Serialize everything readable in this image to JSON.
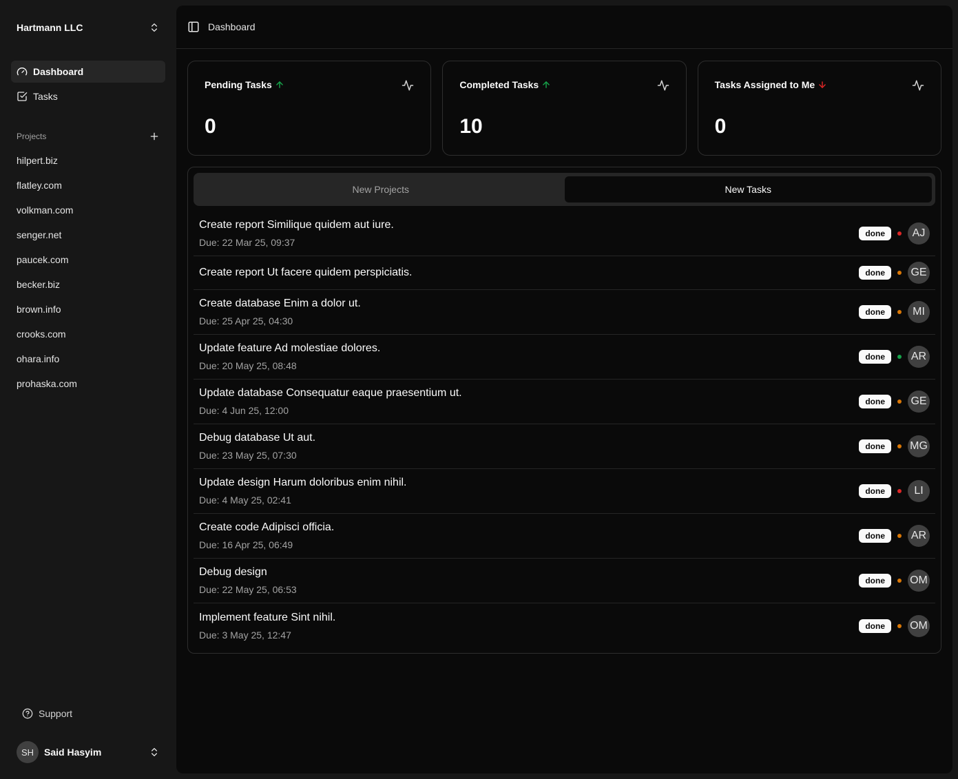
{
  "colors": {
    "priority_high": "#dc2626",
    "priority_medium": "#d97706",
    "priority_low": "#16a34a",
    "trend_up": "#16a34a",
    "trend_down": "#dc2626"
  },
  "sidebar": {
    "team_name": "Hartmann LLC",
    "nav": [
      {
        "label": "Dashboard",
        "icon": "gauge-icon",
        "active": true
      },
      {
        "label": "Tasks",
        "icon": "square-check-icon",
        "active": false
      }
    ],
    "projects_label": "Projects",
    "projects": [
      "hilpert.biz",
      "flatley.com",
      "volkman.com",
      "senger.net",
      "paucek.com",
      "becker.biz",
      "brown.info",
      "crooks.com",
      "ohara.info",
      "prohaska.com"
    ],
    "support_label": "Support",
    "user": {
      "initials": "SH",
      "name": "Said Hasyim"
    }
  },
  "header": {
    "breadcrumb": "Dashboard"
  },
  "stats": [
    {
      "title": "Pending Tasks",
      "trend": "up",
      "value": "0"
    },
    {
      "title": "Completed Tasks",
      "trend": "up",
      "value": "10"
    },
    {
      "title": "Tasks Assigned to Me",
      "trend": "down",
      "value": "0"
    }
  ],
  "tabs": [
    {
      "label": "New Projects",
      "active": false
    },
    {
      "label": "New Tasks",
      "active": true
    }
  ],
  "tasks": [
    {
      "title": "Create report Similique quidem aut iure.",
      "due": "Due: 22 Mar 25, 09:37",
      "status": "done",
      "priority": "high",
      "assignee": "AJ"
    },
    {
      "title": "Create report Ut facere quidem perspiciatis.",
      "due": "",
      "status": "done",
      "priority": "medium",
      "assignee": "GE"
    },
    {
      "title": "Create database Enim a dolor ut.",
      "due": "Due: 25 Apr 25, 04:30",
      "status": "done",
      "priority": "medium",
      "assignee": "MI"
    },
    {
      "title": "Update feature Ad molestiae dolores.",
      "due": "Due: 20 May 25, 08:48",
      "status": "done",
      "priority": "low",
      "assignee": "AR"
    },
    {
      "title": "Update database Consequatur eaque praesentium ut.",
      "due": "Due: 4 Jun 25, 12:00",
      "status": "done",
      "priority": "medium",
      "assignee": "GE"
    },
    {
      "title": "Debug database Ut aut.",
      "due": "Due: 23 May 25, 07:30",
      "status": "done",
      "priority": "medium",
      "assignee": "MG"
    },
    {
      "title": "Update design Harum doloribus enim nihil.",
      "due": "Due: 4 May 25, 02:41",
      "status": "done",
      "priority": "high",
      "assignee": "LI"
    },
    {
      "title": "Create code Adipisci officia.",
      "due": "Due: 16 Apr 25, 06:49",
      "status": "done",
      "priority": "medium",
      "assignee": "AR"
    },
    {
      "title": "Debug design",
      "due": "Due: 22 May 25, 06:53",
      "status": "done",
      "priority": "medium",
      "assignee": "OM"
    },
    {
      "title": "Implement feature Sint nihil.",
      "due": "Due: 3 May 25, 12:47",
      "status": "done",
      "priority": "medium",
      "assignee": "OM"
    }
  ]
}
